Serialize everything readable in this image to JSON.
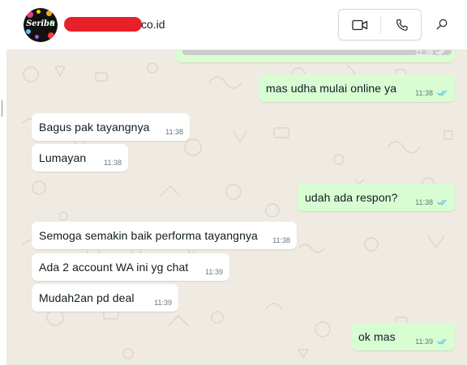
{
  "header": {
    "contact_name_visible": "co.id",
    "avatar_text": "Seribu",
    "video_call_icon": "video-camera-icon",
    "voice_call_icon": "phone-icon",
    "search_icon": "search-icon"
  },
  "colors": {
    "incoming_bubble": "#ffffff",
    "outgoing_bubble": "#d9fdd3",
    "chat_background": "#efeae2",
    "read_tick": "#53bdeb",
    "redaction": "#e8202a"
  },
  "messages": [
    {
      "direction": "out",
      "text": "",
      "time": "11:38",
      "status": "read",
      "kind": "image"
    },
    {
      "direction": "out",
      "text": "mas udha mulai online ya",
      "time": "11:38",
      "status": "read"
    },
    {
      "direction": "in",
      "text": "Bagus pak tayangnya",
      "time": "11:38"
    },
    {
      "direction": "in",
      "text": "Lumayan",
      "time": "11:38"
    },
    {
      "direction": "out",
      "text": "udah ada respon?",
      "time": "11:38",
      "status": "read"
    },
    {
      "direction": "in",
      "text": "Semoga semakin baik performa tayangnya",
      "time": "11:38"
    },
    {
      "direction": "in",
      "text": "Ada 2 account WA ini yg chat",
      "time": "11:39"
    },
    {
      "direction": "in",
      "text": "Mudah2an pd deal",
      "time": "11:39"
    },
    {
      "direction": "out",
      "text": "ok mas",
      "time": "11:39",
      "status": "read"
    }
  ]
}
